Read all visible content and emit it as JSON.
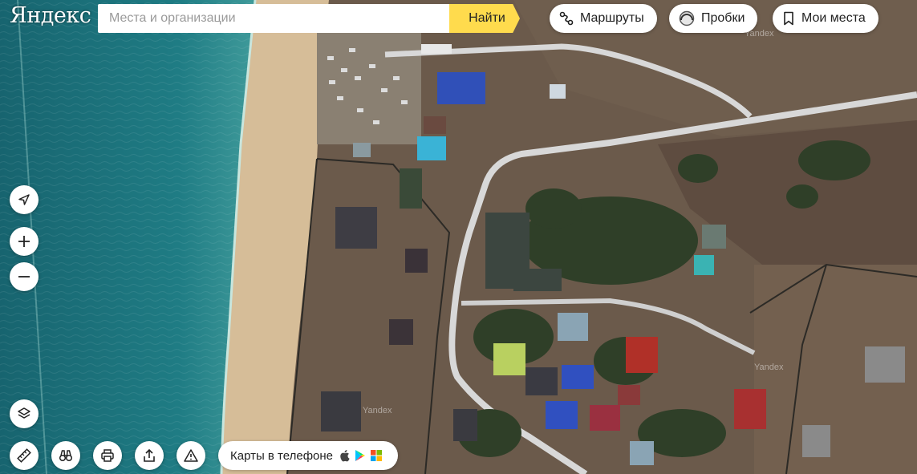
{
  "logo": {
    "text": "Яндекс"
  },
  "search": {
    "placeholder": "Места и организации",
    "button_label": "Найти"
  },
  "header_buttons": {
    "routes": "Маршруты",
    "traffic": "Пробки",
    "my_places": "Мои места"
  },
  "apps_banner": {
    "label": "Карты в телефоне"
  },
  "watermarks": [
    "Yandex",
    "Yandex",
    "Yandex"
  ],
  "colors": {
    "accent": "#ffdb4d",
    "sea": "#1e6f7a",
    "beach": "#d9c3a0",
    "land": "#6b5b4c",
    "road": "#d8d8d8"
  },
  "icons": {
    "geolocation": "arrow-icon",
    "zoom_in": "plus-icon",
    "zoom_out": "minus-icon",
    "layers": "layers-icon",
    "ruler": "ruler-icon",
    "panorama": "binoculars-icon",
    "print": "printer-icon",
    "share": "share-icon",
    "report": "warning-icon"
  }
}
